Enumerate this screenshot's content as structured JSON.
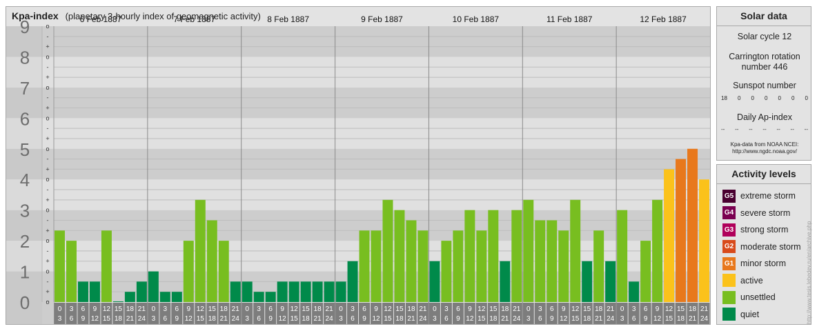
{
  "header": {
    "title": "Kpa-index",
    "subtitle": "(planetary 3-hourly index of geomagnetic activity)"
  },
  "solar_data": {
    "heading": "Solar data",
    "cycle": "Solar cycle 12",
    "rotation_line1": "Carrington rotation",
    "rotation_line2": "number 446",
    "sunspot_heading": "Sunspot number",
    "sunspot_values": [
      "18",
      "0",
      "0",
      "0",
      "0",
      "0",
      "0"
    ],
    "ap_heading": "Daily Ap-index",
    "ap_values": [
      "--",
      "--",
      "--",
      "--",
      "--",
      "--",
      "--"
    ],
    "source_line1": "Kpa-data from NOAA NCEI:",
    "source_line2": "http://www.ngdc.noaa.gov/"
  },
  "activity_levels": {
    "heading": "Activity levels",
    "items": [
      {
        "badge": "G5",
        "label": "extreme storm",
        "color": "#4a0030"
      },
      {
        "badge": "G4",
        "label": "severe storm",
        "color": "#7a0050"
      },
      {
        "badge": "G3",
        "label": "strong storm",
        "color": "#b0005a"
      },
      {
        "badge": "G2",
        "label": "moderate storm",
        "color": "#d84a1b"
      },
      {
        "badge": "G1",
        "label": "minor storm",
        "color": "#e8781c"
      },
      {
        "badge": "",
        "label": "active",
        "color": "#fbc21b"
      },
      {
        "badge": "",
        "label": "unsettled",
        "color": "#78be20"
      },
      {
        "badge": "",
        "label": "quiet",
        "color": "#008a4a"
      }
    ]
  },
  "credit": "http://www.tesis.lebedev.ru/en/archive.php",
  "chart_data": {
    "type": "bar",
    "title": "Kpa-index",
    "subtitle": "(planetary 3-hourly index of geomagnetic activity)",
    "ylim": [
      0,
      9
    ],
    "y_ticks": [
      "0",
      "1",
      "2",
      "3",
      "4",
      "5",
      "6",
      "7",
      "8",
      "9"
    ],
    "sub_ticks": [
      "o",
      "+",
      "-"
    ],
    "days": [
      "6 Feb 1887",
      "7 Feb 1887",
      "8 Feb 1887",
      "9 Feb 1887",
      "10 Feb 1887",
      "11 Feb 1887",
      "12 Feb 1887"
    ],
    "interval_starts": [
      "0",
      "3",
      "6",
      "9",
      "12",
      "15",
      "18",
      "21"
    ],
    "interval_ends": [
      "3",
      "6",
      "9",
      "12",
      "15",
      "18",
      "21",
      "24"
    ],
    "values": [
      2.333,
      2.0,
      0.667,
      0.667,
      2.333,
      0.0,
      0.333,
      0.667,
      1.0,
      0.333,
      0.333,
      2.0,
      3.333,
      2.667,
      2.0,
      0.667,
      0.667,
      0.333,
      0.333,
      0.667,
      0.667,
      0.667,
      0.667,
      0.667,
      0.667,
      1.333,
      2.333,
      2.333,
      3.333,
      3.0,
      2.667,
      2.333,
      1.333,
      2.0,
      2.333,
      3.0,
      2.333,
      3.0,
      1.333,
      3.0,
      3.333,
      2.667,
      2.667,
      2.333,
      3.333,
      1.333,
      2.333,
      1.333,
      3.0,
      0.667,
      2.0,
      3.333,
      4.333,
      4.667,
      5.0,
      4.0
    ],
    "level_colors": {
      "quiet": "#008a4a",
      "unsettled": "#78be20",
      "active": "#fbc21b",
      "minor_storm": "#e8781c",
      "moderate_storm": "#d84a1b"
    },
    "grid": true
  }
}
